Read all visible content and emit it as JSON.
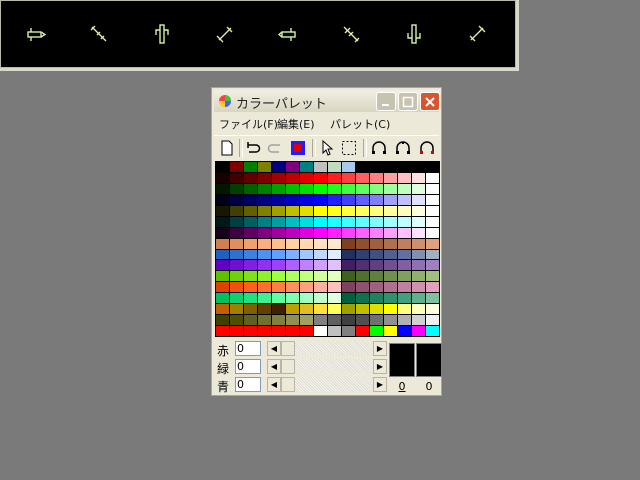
{
  "sprites": [
    "sprite-1-icon",
    "sprite-2-icon",
    "sprite-3-icon",
    "sprite-4-icon",
    "sprite-5-icon",
    "sprite-6-icon",
    "sprite-7-icon",
    "sprite-8-icon"
  ],
  "window": {
    "title": "カラーパレット",
    "menu": [
      "ファイル(F)",
      "編集(E)",
      "パレット(C)"
    ]
  },
  "palette": [
    [
      "#000000",
      "#800000",
      "#008000",
      "#808000",
      "#000080",
      "#800080",
      "#008080",
      "#c0c0c0",
      "#c0dcc0",
      "#a6caf0",
      "#000000",
      "#000000",
      "#000000",
      "#000000",
      "#000000",
      "#000000"
    ],
    [
      "#180000",
      "#400000",
      "#600000",
      "#800000",
      "#a00000",
      "#c00000",
      "#e00000",
      "#ff0000",
      "#ff2020",
      "#ff4040",
      "#ff6060",
      "#ff8080",
      "#ffa0a0",
      "#ffc0c0",
      "#ffe0e0",
      "#ffffff"
    ],
    [
      "#001800",
      "#004000",
      "#006000",
      "#008000",
      "#00a000",
      "#00c000",
      "#00e000",
      "#00ff00",
      "#20ff20",
      "#40ff40",
      "#60ff60",
      "#80ff80",
      "#a0ffa0",
      "#c0ffc0",
      "#e0ffe0",
      "#ffffff"
    ],
    [
      "#000018",
      "#000040",
      "#000060",
      "#000080",
      "#0000a0",
      "#0000c0",
      "#0000e0",
      "#0000ff",
      "#2020ff",
      "#4040ff",
      "#6060ff",
      "#8080ff",
      "#a0a0ff",
      "#c0c0ff",
      "#e0e0ff",
      "#ffffff"
    ],
    [
      "#181800",
      "#404000",
      "#606000",
      "#808000",
      "#a0a000",
      "#c0c000",
      "#e0e000",
      "#ffff00",
      "#ffff20",
      "#ffff40",
      "#ffff60",
      "#ffff80",
      "#ffffa0",
      "#ffffc0",
      "#ffffe0",
      "#ffffff"
    ],
    [
      "#001818",
      "#004040",
      "#006060",
      "#008080",
      "#00a0a0",
      "#00c0c0",
      "#00e0e0",
      "#00ffff",
      "#20ffff",
      "#40ffff",
      "#60ffff",
      "#80ffff",
      "#a0ffff",
      "#c0ffff",
      "#e0ffff",
      "#ffffff"
    ],
    [
      "#180018",
      "#400040",
      "#600060",
      "#800080",
      "#a000a0",
      "#c000c0",
      "#e000e0",
      "#ff00ff",
      "#ff20ff",
      "#ff40ff",
      "#ff60ff",
      "#ff80ff",
      "#ffa0ff",
      "#ffc0ff",
      "#ffe0ff",
      "#ffffff"
    ],
    [
      "#d08050",
      "#e09060",
      "#f0a070",
      "#f8b080",
      "#ffc090",
      "#ffd0a0",
      "#ffd8b0",
      "#ffe0c0",
      "#ffe8d0",
      "#804020",
      "#905030",
      "#a06040",
      "#b07050",
      "#c08060",
      "#d09070",
      "#e0a080"
    ],
    [
      "#2060c0",
      "#3070d0",
      "#4080e0",
      "#5090f0",
      "#60a0ff",
      "#80b0ff",
      "#a0c8ff",
      "#c0d8ff",
      "#e0ecff",
      "#203060",
      "#304070",
      "#405080",
      "#506090",
      "#6070a0",
      "#8090b0",
      "#a0b0c0"
    ],
    [
      "#6000c0",
      "#7010d0",
      "#8020e0",
      "#9030f0",
      "#a040ff",
      "#b060ff",
      "#c080ff",
      "#d0a0ff",
      "#e0c0ff",
      "#402060",
      "#503070",
      "#604080",
      "#705090",
      "#8060a0",
      "#9070b0",
      "#a080c0"
    ],
    [
      "#60c000",
      "#70d010",
      "#80e020",
      "#90f030",
      "#a0ff40",
      "#b0ff60",
      "#c0ff80",
      "#d0ffa0",
      "#e0ffc0",
      "#406020",
      "#507030",
      "#608040",
      "#709050",
      "#80a060",
      "#90b070",
      "#a0c080"
    ],
    [
      "#e04000",
      "#f05010",
      "#ff6020",
      "#ff7030",
      "#ff8040",
      "#ff9060",
      "#ffa080",
      "#ffb0a0",
      "#ffc0c0",
      "#804060",
      "#905070",
      "#a06080",
      "#b07090",
      "#c080a0",
      "#d090b0",
      "#e0a0c0"
    ],
    [
      "#00c060",
      "#10d070",
      "#20e080",
      "#40f090",
      "#60ffa0",
      "#80ffb0",
      "#a0ffc0",
      "#c0ffd0",
      "#e0ffe0",
      "#006040",
      "#107050",
      "#208060",
      "#309070",
      "#40a080",
      "#60b090",
      "#80c0a0"
    ],
    [
      "#c06000",
      "#a08000",
      "#806000",
      "#604000",
      "#402000",
      "#c0a000",
      "#e0c020",
      "#ffe040",
      "#ffff60",
      "#a0a000",
      "#c0c000",
      "#e0e000",
      "#ffff00",
      "#ffff80",
      "#ffffc0",
      "#ffffe0"
    ],
    [
      "#404000",
      "#505000",
      "#606020",
      "#707030",
      "#808040",
      "#909050",
      "#a0a060",
      "#808080",
      "#606060",
      "#404040",
      "#505050",
      "#707070",
      "#909090",
      "#b0b0b0",
      "#d0d0d0",
      "#f0f0f0"
    ],
    [
      "#ff0000",
      "#ff0000",
      "#ff0000",
      "#ff0000",
      "#ff0000",
      "#ff0000",
      "#ff0000",
      "#ffffff",
      "#c0c0c0",
      "#808080",
      "#ff0000",
      "#00ff00",
      "#ffff00",
      "#0000ff",
      "#ff00ff",
      "#00ffff"
    ]
  ],
  "sliders": [
    {
      "label": "赤",
      "value": "0"
    },
    {
      "label": "緑",
      "value": "0"
    },
    {
      "label": "青",
      "value": "0"
    }
  ],
  "color_values": [
    "0",
    "0"
  ],
  "colors": {
    "title_close": "#d8552f",
    "swatch": "#000000"
  }
}
